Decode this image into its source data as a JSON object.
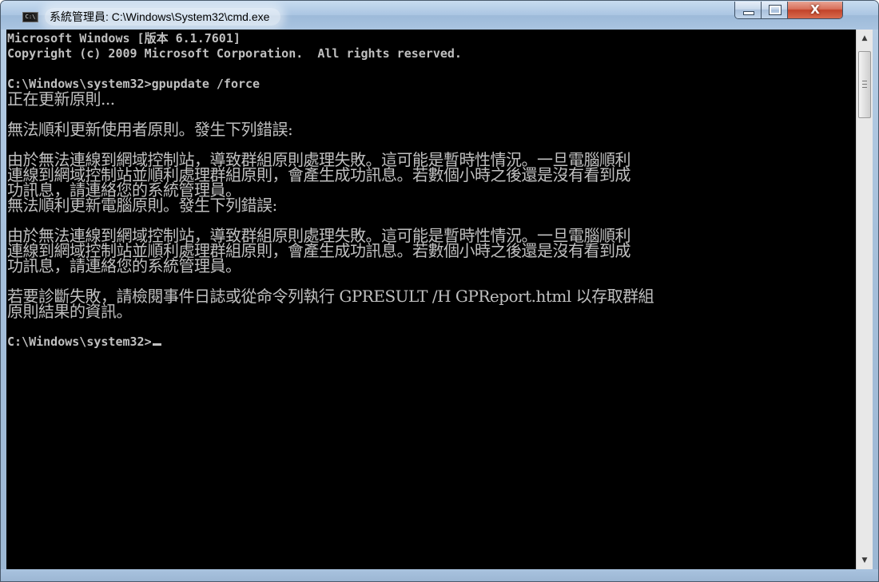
{
  "window": {
    "title": "系統管理員: C:\\Windows\\System32\\cmd.exe",
    "icon": "console-app-icon",
    "icon_text": "C:\\",
    "close_glyph": "X"
  },
  "console": {
    "text_color": "#c0c0c0",
    "background": "#000000",
    "lines": [
      {
        "text": "Microsoft Windows [版本 6.1.7601]",
        "style": "mono"
      },
      {
        "text": "Copyright (c) 2009 Microsoft Corporation.  All rights reserved.",
        "style": "mono"
      },
      {
        "text": "",
        "style": "blank"
      },
      {
        "text": "C:\\Windows\\system32>gpupdate /force",
        "style": "mono"
      },
      {
        "text": "正在更新原則...",
        "style": "cjk"
      },
      {
        "text": "",
        "style": "blank"
      },
      {
        "text": "無法順利更新使用者原則。發生下列錯誤:",
        "style": "cjk"
      },
      {
        "text": "",
        "style": "blank"
      },
      {
        "text": "由於無法連線到網域控制站，導致群組原則處理失敗。這可能是暫時性情況。一旦電腦順利",
        "style": "cjk"
      },
      {
        "text": "連線到網域控制站並順利處理群組原則，會產生成功訊息。若數個小時之後還是沒有看到成",
        "style": "cjk"
      },
      {
        "text": "功訊息，請連絡您的系統管理員。",
        "style": "cjk"
      },
      {
        "text": "無法順利更新電腦原則。發生下列錯誤:",
        "style": "cjk"
      },
      {
        "text": "",
        "style": "blank"
      },
      {
        "text": "由於無法連線到網域控制站，導致群組原則處理失敗。這可能是暫時性情況。一旦電腦順利",
        "style": "cjk"
      },
      {
        "text": "連線到網域控制站並順利處理群組原則，會產生成功訊息。若數個小時之後還是沒有看到成",
        "style": "cjk"
      },
      {
        "text": "功訊息，請連絡您的系統管理員。",
        "style": "cjk"
      },
      {
        "text": "",
        "style": "blank"
      },
      {
        "text": "若要診斷失敗，請檢閱事件日誌或從命令列執行 GPRESULT /H GPReport.html 以存取群組",
        "style": "cjk"
      },
      {
        "text": "原則結果的資訊。",
        "style": "cjk"
      },
      {
        "text": "",
        "style": "blank"
      },
      {
        "text": "C:\\Windows\\system32>",
        "style": "mono",
        "cursor": true
      }
    ]
  },
  "scrollbar": {
    "up_arrow": "▲",
    "down_arrow": "▼"
  }
}
